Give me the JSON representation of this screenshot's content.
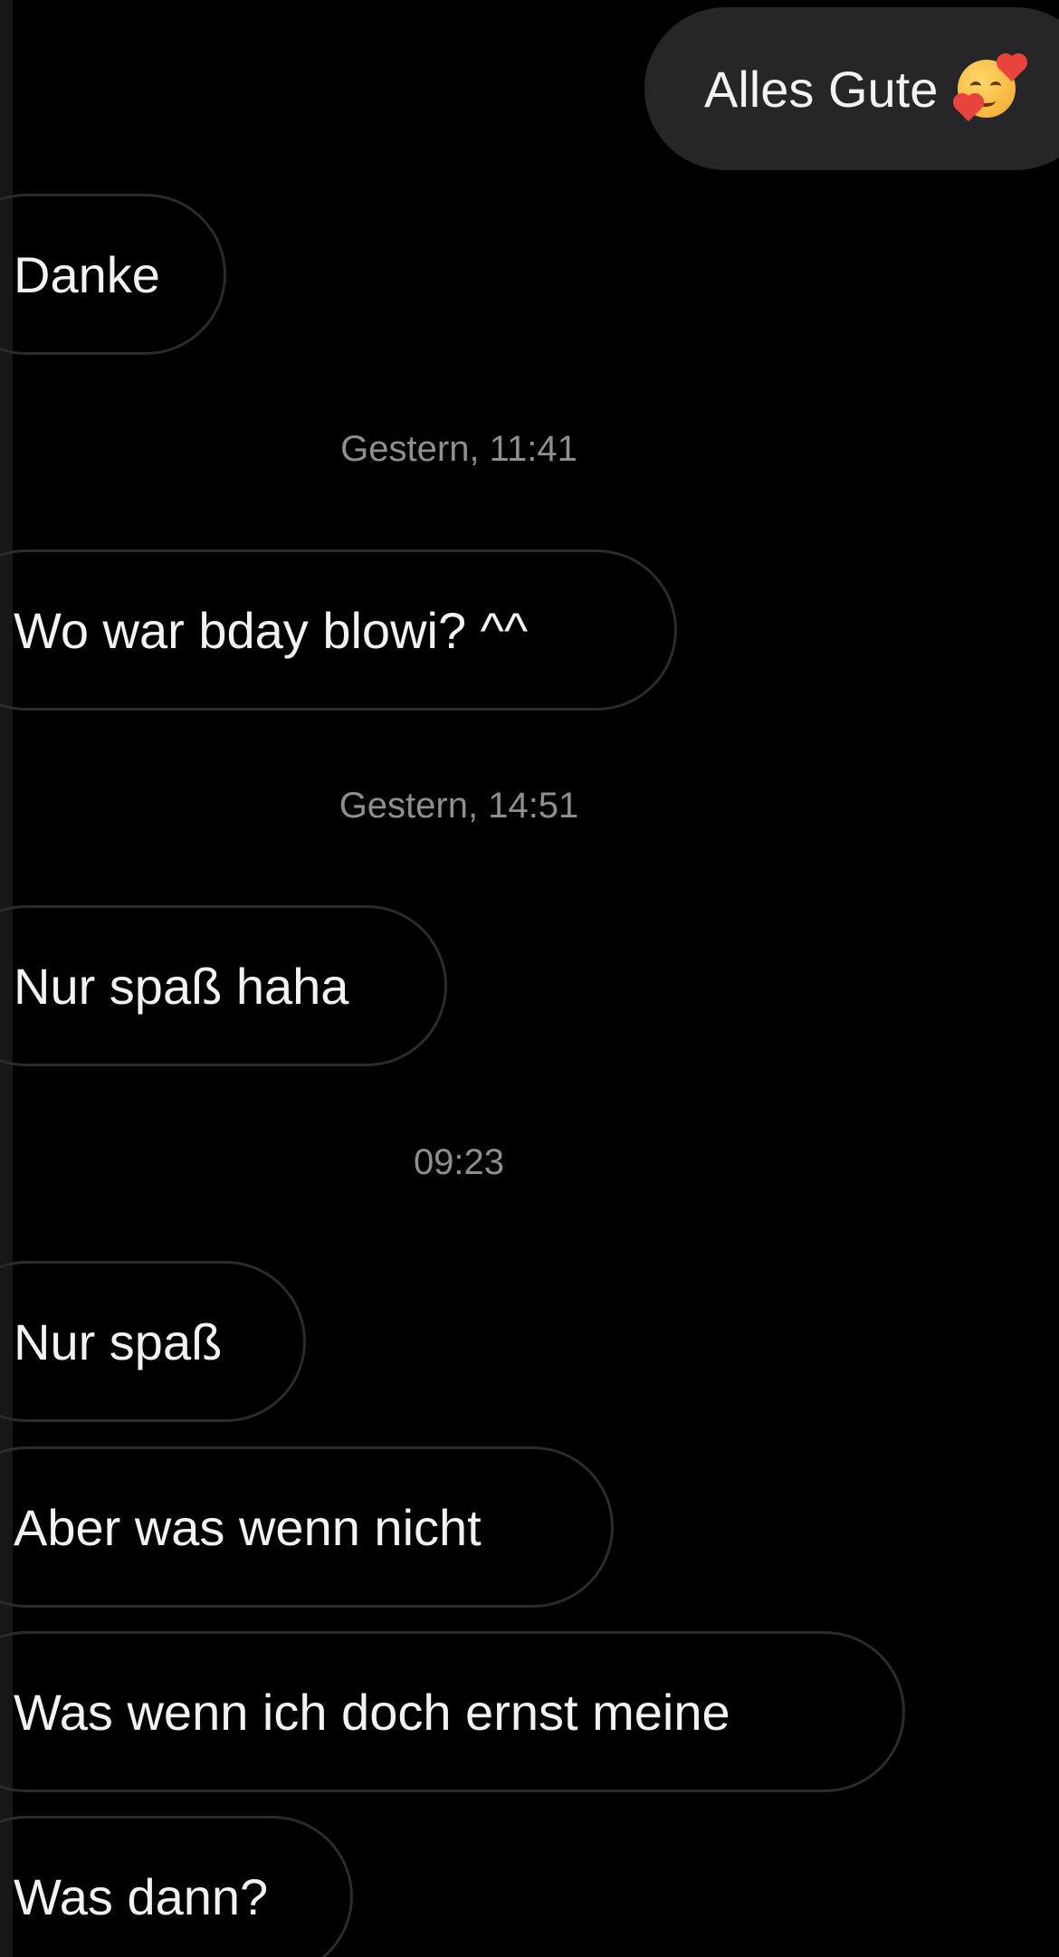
{
  "conversation": {
    "sent_message": {
      "text": "Alles Gute",
      "emoji_icon": "smiling-face-with-hearts-icon"
    },
    "messages": [
      {
        "type": "received",
        "text": "Danke"
      },
      {
        "type": "timestamp",
        "text": "Gestern, 11:41"
      },
      {
        "type": "received",
        "text": "Wo war bday blowi? ^^"
      },
      {
        "type": "timestamp",
        "text": "Gestern, 14:51"
      },
      {
        "type": "received",
        "text": "Nur spaß haha"
      },
      {
        "type": "timestamp",
        "text": "09:23"
      },
      {
        "type": "received",
        "text": "Nur spaß"
      },
      {
        "type": "received",
        "text": "Aber was wenn nicht"
      },
      {
        "type": "received",
        "text": "Was wenn ich doch ernst meine"
      },
      {
        "type": "received",
        "text": "Was dann?"
      }
    ]
  },
  "colors": {
    "background": "#000000",
    "sent_bubble": "#262629",
    "received_border": "#2b2b2e",
    "message_text": "#f2f2f2",
    "timestamp_text": "#8e8e93"
  }
}
